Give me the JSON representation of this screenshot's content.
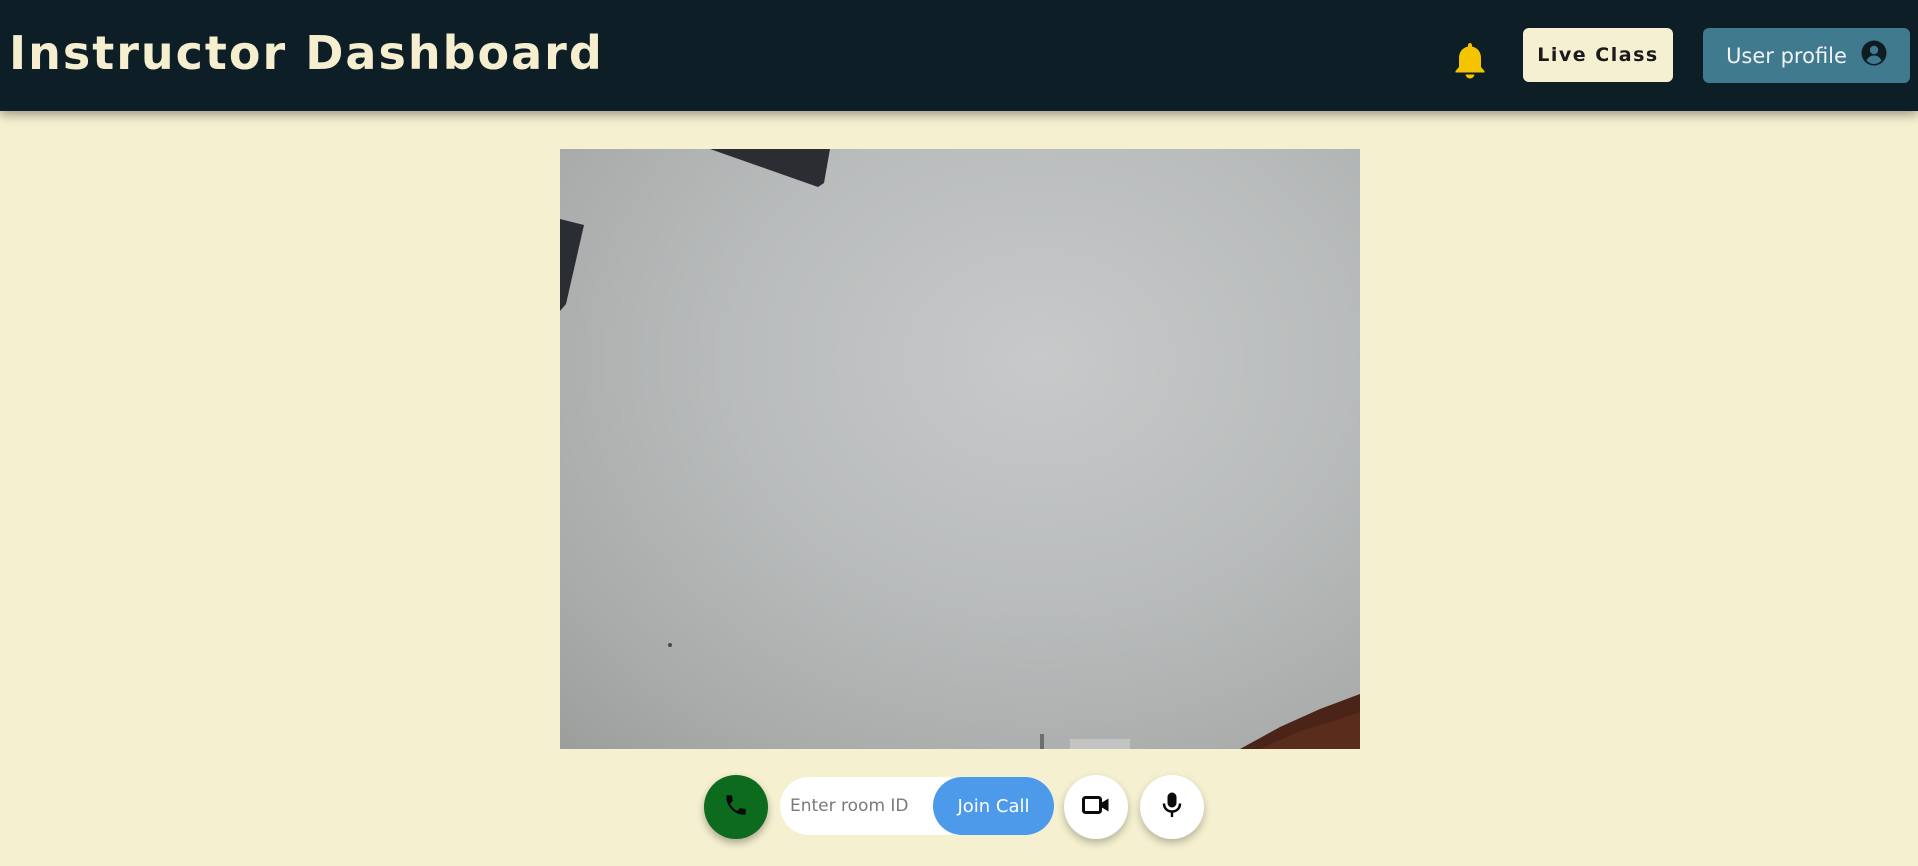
{
  "header": {
    "title": "Instructor Dashboard",
    "notification_icon": "bell-icon",
    "live_class_label": "Live Class",
    "profile_label": "User profile",
    "profile_icon": "user-circle-icon"
  },
  "video": {
    "content": "local camera preview"
  },
  "controls": {
    "call_icon": "phone-icon",
    "room_input": {
      "placeholder": "Enter room ID",
      "value": ""
    },
    "join_label": "Join Call",
    "camera_icon": "video-camera-icon",
    "mic_icon": "microphone-icon"
  },
  "colors": {
    "header_bg": "#0e1e27",
    "page_bg": "#f5f0d0",
    "title": "#f5efcf",
    "bell": "#f5c400",
    "profile_bg": "#3f7a8e",
    "call_green": "#0d6b1e",
    "join_blue": "#4d9aea"
  }
}
